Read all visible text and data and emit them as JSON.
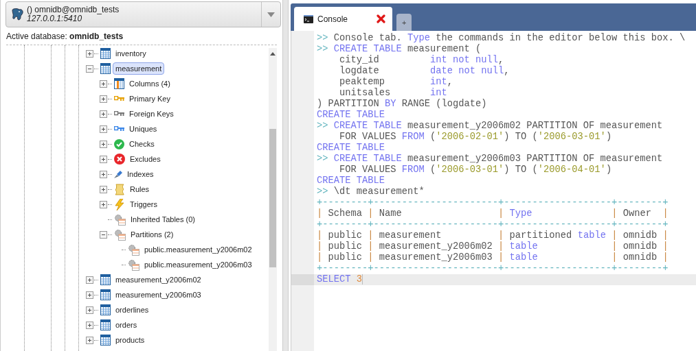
{
  "connection": {
    "name": "() omnidb@omnidb_tests",
    "address": "127.0.0.1:5410"
  },
  "active_database": "Active database: **omnidb_tests**",
  "tree": [
    {
      "label": "inventory",
      "kind": "table",
      "expanded": false,
      "selected": false
    },
    {
      "label": "measurement",
      "kind": "table",
      "expanded": true,
      "selected": true,
      "children": [
        {
          "label": "Columns (4)",
          "kind": "columns",
          "expanded": false,
          "selected": false
        },
        {
          "label": "Primary Key",
          "kind": "primary_key",
          "expanded": false,
          "selected": false
        },
        {
          "label": "Foreign Keys",
          "kind": "foreign_key",
          "expanded": false,
          "selected": false
        },
        {
          "label": "Uniques",
          "kind": "unique",
          "expanded": false,
          "selected": false
        },
        {
          "label": "Checks",
          "kind": "check",
          "expanded": false,
          "selected": false
        },
        {
          "label": "Excludes",
          "kind": "exclude",
          "expanded": false,
          "selected": false
        },
        {
          "label": "Indexes",
          "kind": "index",
          "expanded": false,
          "selected": false
        },
        {
          "label": "Rules",
          "kind": "rule",
          "expanded": false,
          "selected": false
        },
        {
          "label": "Triggers",
          "kind": "trigger",
          "expanded": false,
          "selected": false
        },
        {
          "label": "Inherited Tables (0)",
          "kind": "group",
          "selected": false
        },
        {
          "label": "Partitions (2)",
          "kind": "group",
          "expanded": true,
          "selected": false,
          "children": [
            {
              "label": "public.measurement_y2006m02",
              "kind": "group",
              "selected": false
            },
            {
              "label": "public.measurement_y2006m03",
              "kind": "group",
              "selected": false
            }
          ]
        }
      ]
    },
    {
      "label": "measurement_y2006m02",
      "kind": "table",
      "expanded": false,
      "selected": false
    },
    {
      "label": "measurement_y2006m03",
      "kind": "table",
      "expanded": false,
      "selected": false
    },
    {
      "label": "orderlines",
      "kind": "table",
      "expanded": false,
      "selected": false
    },
    {
      "label": "orders",
      "kind": "table",
      "expanded": false,
      "selected": false
    },
    {
      "label": "products",
      "kind": "table",
      "expanded": false,
      "selected": false
    }
  ],
  "tabs": [
    {
      "label": "Console",
      "kind": "console",
      "selected": true
    },
    {
      "label": "+",
      "kind": "add",
      "selected": false
    }
  ],
  "console_lines": [
    {
      "active": false,
      "tokens": [
        {
          "kind": "prompt",
          "text": ">> "
        },
        {
          "kind": "plain",
          "text": "Console tab. "
        },
        {
          "kind": "keyword",
          "text": "Type"
        },
        {
          "kind": "plain",
          "text": " the commands in the editor below this box. \\"
        }
      ]
    },
    {
      "active": false,
      "tokens": [
        {
          "kind": "prompt",
          "text": ">> "
        },
        {
          "kind": "keyword",
          "text": "CREATE TABLE"
        },
        {
          "kind": "plain",
          "text": " measurement ("
        }
      ]
    },
    {
      "active": false,
      "tokens": [
        {
          "kind": "plain",
          "text": "    city_id         "
        },
        {
          "kind": "keyword",
          "text": "int not null"
        },
        {
          "kind": "plain",
          "text": ","
        }
      ]
    },
    {
      "active": false,
      "tokens": [
        {
          "kind": "plain",
          "text": "    logdate         "
        },
        {
          "kind": "keyword",
          "text": "date not null"
        },
        {
          "kind": "plain",
          "text": ","
        }
      ]
    },
    {
      "active": false,
      "tokens": [
        {
          "kind": "plain",
          "text": "    peaktemp        "
        },
        {
          "kind": "keyword",
          "text": "int"
        },
        {
          "kind": "plain",
          "text": ","
        }
      ]
    },
    {
      "active": false,
      "tokens": [
        {
          "kind": "plain",
          "text": "    unitsales       "
        },
        {
          "kind": "keyword",
          "text": "int"
        }
      ]
    },
    {
      "active": false,
      "tokens": [
        {
          "kind": "plain",
          "text": ") PARTITION "
        },
        {
          "kind": "keyword",
          "text": "BY"
        },
        {
          "kind": "plain",
          "text": " RANGE (logdate)"
        }
      ]
    },
    {
      "active": false,
      "tokens": [
        {
          "kind": "keyword",
          "text": "CREATE TABLE"
        }
      ]
    },
    {
      "active": false,
      "tokens": [
        {
          "kind": "prompt",
          "text": ">> "
        },
        {
          "kind": "keyword",
          "text": "CREATE TABLE"
        },
        {
          "kind": "plain",
          "text": " measurement_y2006m02 PARTITION OF measurement"
        }
      ]
    },
    {
      "active": false,
      "tokens": [
        {
          "kind": "plain",
          "text": "    FOR VALUES "
        },
        {
          "kind": "keyword",
          "text": "FROM"
        },
        {
          "kind": "plain",
          "text": " ("
        },
        {
          "kind": "string",
          "text": "'2006-02-01'"
        },
        {
          "kind": "plain",
          "text": ") TO ("
        },
        {
          "kind": "string",
          "text": "'2006-03-01'"
        },
        {
          "kind": "plain",
          "text": ")"
        }
      ]
    },
    {
      "active": false,
      "tokens": [
        {
          "kind": "keyword",
          "text": "CREATE TABLE"
        }
      ]
    },
    {
      "active": false,
      "tokens": [
        {
          "kind": "prompt",
          "text": ">> "
        },
        {
          "kind": "keyword",
          "text": "CREATE TABLE"
        },
        {
          "kind": "plain",
          "text": " measurement_y2006m03 PARTITION OF measurement"
        }
      ]
    },
    {
      "active": false,
      "tokens": [
        {
          "kind": "plain",
          "text": "    FOR VALUES "
        },
        {
          "kind": "keyword",
          "text": "FROM"
        },
        {
          "kind": "plain",
          "text": " ("
        },
        {
          "kind": "string",
          "text": "'2006-03-01'"
        },
        {
          "kind": "plain",
          "text": ") TO ("
        },
        {
          "kind": "string",
          "text": "'2006-04-01'"
        },
        {
          "kind": "plain",
          "text": ")"
        }
      ]
    },
    {
      "active": false,
      "tokens": [
        {
          "kind": "keyword",
          "text": "CREATE TABLE"
        }
      ]
    },
    {
      "active": false,
      "tokens": [
        {
          "kind": "prompt",
          "text": ">> "
        },
        {
          "kind": "plain",
          "text": "\\dt measurement*"
        }
      ]
    },
    {
      "active": false,
      "tokens": [
        {
          "kind": "border",
          "text": "+--------+----------------------+-------------------+--------+"
        }
      ]
    },
    {
      "active": false,
      "tokens": [
        {
          "kind": "pipe",
          "text": "|"
        },
        {
          "kind": "plain",
          "text": " Schema "
        },
        {
          "kind": "pipe",
          "text": "|"
        },
        {
          "kind": "plain",
          "text": " Name                 "
        },
        {
          "kind": "pipe",
          "text": "| "
        },
        {
          "kind": "keyword",
          "text": "Type"
        },
        {
          "kind": "pipe",
          "text": "              |"
        },
        {
          "kind": "plain",
          "text": " Owner  "
        },
        {
          "kind": "pipe",
          "text": "|"
        }
      ]
    },
    {
      "active": false,
      "tokens": [
        {
          "kind": "border",
          "text": "+--------+----------------------+-------------------+--------+"
        }
      ]
    },
    {
      "active": false,
      "tokens": [
        {
          "kind": "pipe",
          "text": "|"
        },
        {
          "kind": "plain",
          "text": " public "
        },
        {
          "kind": "pipe",
          "text": "|"
        },
        {
          "kind": "plain",
          "text": " measurement          "
        },
        {
          "kind": "pipe",
          "text": "|"
        },
        {
          "kind": "plain",
          "text": " partitioned "
        },
        {
          "kind": "keyword",
          "text": "table"
        },
        {
          "kind": "pipe",
          "text": " |"
        },
        {
          "kind": "plain",
          "text": " omnidb "
        },
        {
          "kind": "pipe",
          "text": "|"
        }
      ]
    },
    {
      "active": false,
      "tokens": [
        {
          "kind": "pipe",
          "text": "|"
        },
        {
          "kind": "plain",
          "text": " public "
        },
        {
          "kind": "pipe",
          "text": "|"
        },
        {
          "kind": "plain",
          "text": " measurement_y2006m02 "
        },
        {
          "kind": "pipe",
          "text": "| "
        },
        {
          "kind": "keyword",
          "text": "table"
        },
        {
          "kind": "pipe",
          "text": "             |"
        },
        {
          "kind": "plain",
          "text": " omnidb "
        },
        {
          "kind": "pipe",
          "text": "|"
        }
      ]
    },
    {
      "active": false,
      "tokens": [
        {
          "kind": "pipe",
          "text": "|"
        },
        {
          "kind": "plain",
          "text": " public "
        },
        {
          "kind": "pipe",
          "text": "|"
        },
        {
          "kind": "plain",
          "text": " measurement_y2006m03 "
        },
        {
          "kind": "pipe",
          "text": "| "
        },
        {
          "kind": "keyword",
          "text": "table"
        },
        {
          "kind": "pipe",
          "text": "             |"
        },
        {
          "kind": "plain",
          "text": " omnidb "
        },
        {
          "kind": "pipe",
          "text": "|"
        }
      ]
    },
    {
      "active": false,
      "tokens": [
        {
          "kind": "border",
          "text": "+--------+----------------------+-------------------+--------+"
        }
      ]
    },
    {
      "active": true,
      "tokens": [
        {
          "kind": "keyword",
          "text": "SELECT "
        },
        {
          "kind": "number",
          "text": "3"
        }
      ]
    }
  ]
}
